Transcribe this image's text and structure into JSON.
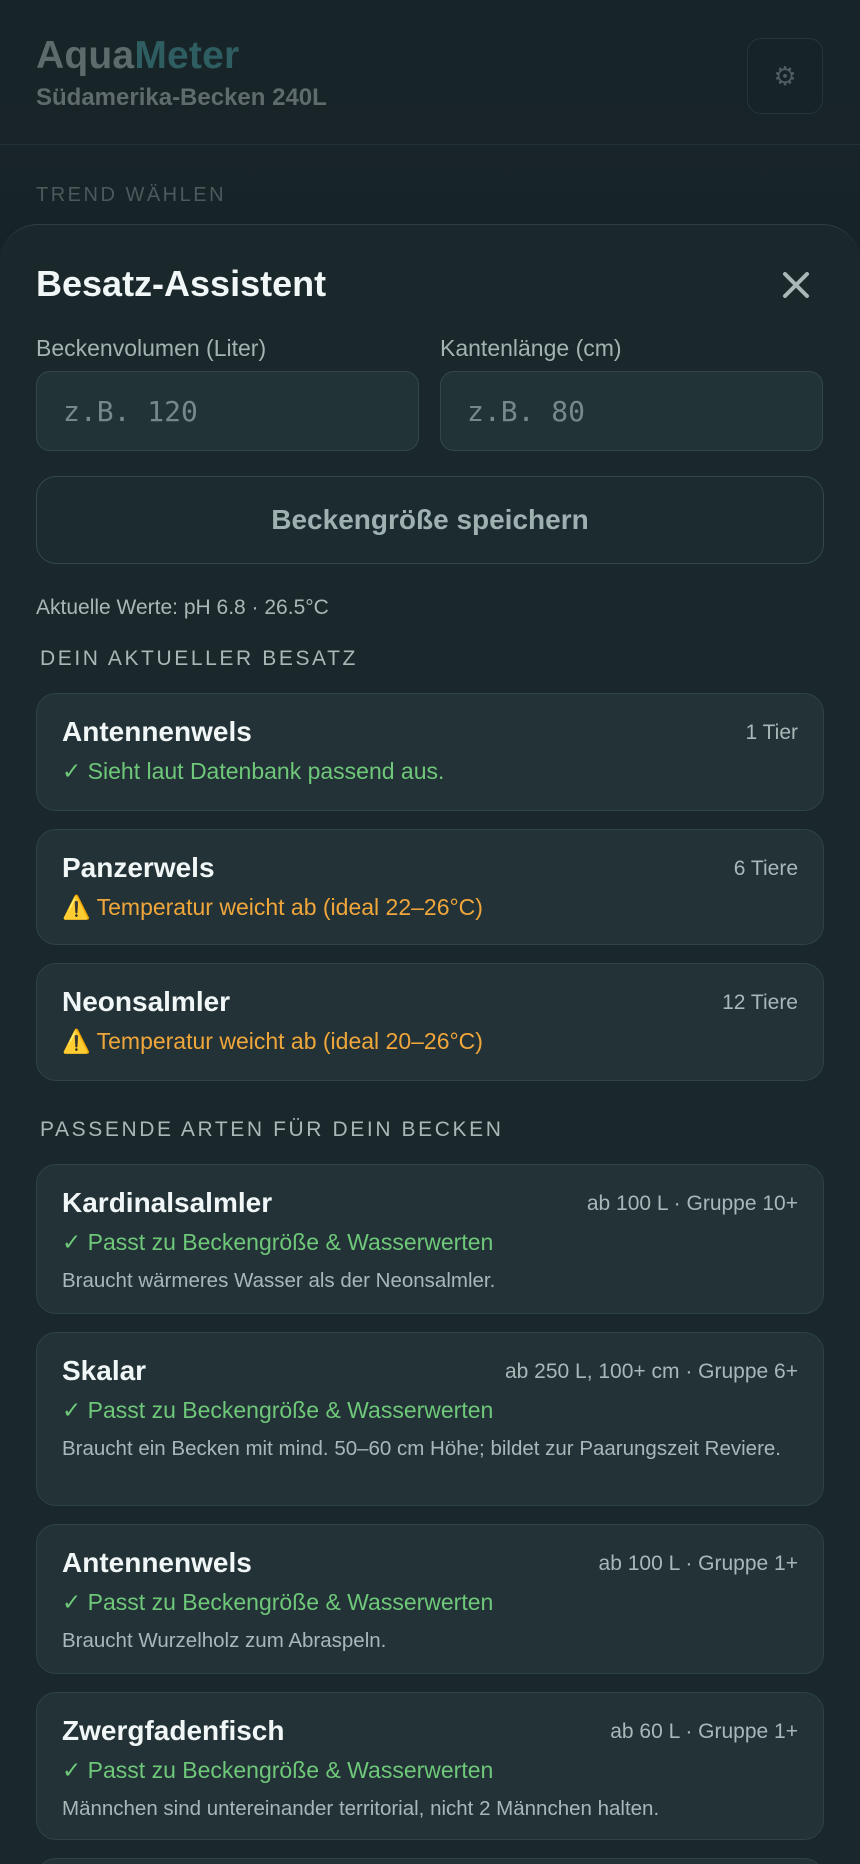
{
  "header": {
    "brand_part1": "Aqua",
    "brand_part2": "Meter",
    "tank_name": "Südamerika-Becken 240L",
    "settings_icon": "gear-icon",
    "trend_label": "TREND WÄHLEN"
  },
  "sheet": {
    "title": "Besatz-Assistent",
    "close_icon": "close-icon",
    "volume_label": "Beckenvolumen (Liter)",
    "volume_placeholder": "z.B. 120",
    "volume_value": "",
    "length_label": "Kantenlänge (cm)",
    "length_placeholder": "z.B. 80",
    "length_value": "",
    "save_label": "Beckengröße speichern",
    "current_values": "Aktuelle Werte: pH 6.8 · 26.5°C"
  },
  "current_stock": {
    "heading": "DEIN AKTUELLER BESATZ",
    "items": [
      {
        "name": "Antennenwels",
        "count": "1 Tier",
        "status": "✓ Sieht laut Datenbank passend aus.",
        "status_type": "ok"
      },
      {
        "name": "Panzerwels",
        "count": "6 Tiere",
        "status": "⚠️ Temperatur weicht ab (ideal 22–26°C)",
        "status_type": "warn"
      },
      {
        "name": "Neonsalmler",
        "count": "12 Tiere",
        "status": "⚠️ Temperatur weicht ab (ideal 20–26°C)",
        "status_type": "warn"
      }
    ]
  },
  "suggestions": {
    "heading": "PASSENDE ARTEN FÜR DEIN BECKEN",
    "items": [
      {
        "name": "Kardinalsalmler",
        "meta": "ab 100 L · Gruppe 10+",
        "status": "✓ Passt zu Beckengröße & Wasserwerten",
        "note": "Braucht wärmeres Wasser als der Neonsalmler."
      },
      {
        "name": "Skalar",
        "meta": "ab 250 L, 100+ cm · Gruppe 6+",
        "status": "✓ Passt zu Beckengröße & Wasserwerten",
        "note": "Braucht ein Becken mit mind. 50–60 cm Höhe; bildet zur Paarungszeit Reviere."
      },
      {
        "name": "Antennenwels",
        "meta": "ab 100 L · Gruppe 1+",
        "status": "✓ Passt zu Beckengröße & Wasserwerten",
        "note": "Braucht Wurzelholz zum Abraspeln."
      },
      {
        "name": "Zwergfadenfisch",
        "meta": "ab 60 L · Gruppe 1+",
        "status": "✓ Passt zu Beckengröße & Wasserwerten",
        "note": "Männchen sind untereinander territorial, nicht 2 Männchen halten."
      }
    ]
  },
  "colors": {
    "ok": "#6fc87a",
    "warn": "#f0a63b",
    "brand_accent": "#2f5e62"
  }
}
